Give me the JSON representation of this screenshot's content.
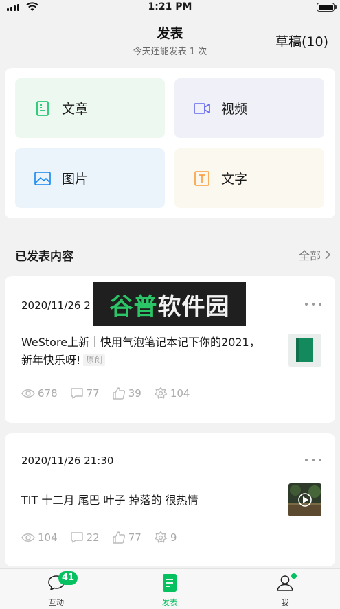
{
  "status_bar": {
    "time": "1:21 PM"
  },
  "header": {
    "title": "发表",
    "subtitle": "今天还能发表 1 次",
    "drafts_label": "草稿(10)"
  },
  "publish_options": [
    {
      "label": "文章",
      "icon": "article-icon",
      "accent": "#07c160"
    },
    {
      "label": "视频",
      "icon": "video-icon",
      "accent": "#6467f0"
    },
    {
      "label": "图片",
      "icon": "image-icon",
      "accent": "#1485ee"
    },
    {
      "label": "文字",
      "icon": "text-icon",
      "accent": "#fa9d3b"
    }
  ],
  "published": {
    "section_title": "已发表内容",
    "view_all_label": "全部",
    "posts": [
      {
        "date": "2020/11/26 2",
        "title": "WeStore上新｜快用气泡笔记本记下你的2021，新年快乐呀!",
        "tag": "原创",
        "thumbnail": "green-notebook",
        "views": "678",
        "comments": "77",
        "likes": "39",
        "shares": "104"
      },
      {
        "date": "2020/11/26 21:30",
        "title": "TIT 十二月 尾巴 叶子 掉落的 很热情",
        "thumbnail": "video-thumbnail",
        "views": "104",
        "comments": "22",
        "likes": "77",
        "shares": "9"
      }
    ]
  },
  "watermark": {
    "part1": "谷普",
    "part2": "软件园"
  },
  "tab_bar": {
    "tabs": [
      {
        "label": "互动",
        "badge": "41"
      },
      {
        "label": "发表"
      },
      {
        "label": "我"
      }
    ]
  },
  "colors": {
    "accent": "#07c160",
    "background": "#f2f2f2"
  }
}
